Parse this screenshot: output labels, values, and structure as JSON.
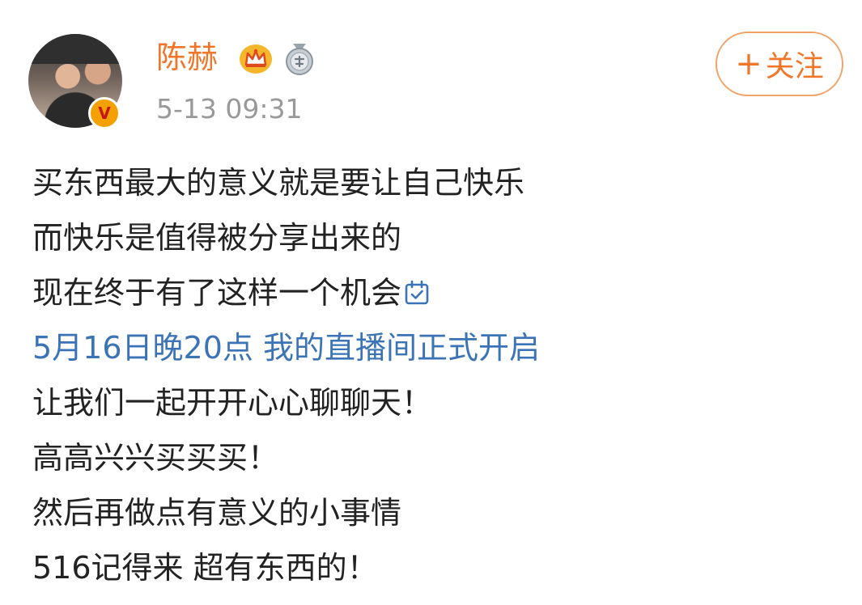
{
  "post": {
    "author": {
      "name": "陈赫",
      "avatar_icon": "avatar-photo",
      "verified_icon": "verified-v-icon",
      "badges": [
        "crown-icon",
        "medal-icon"
      ]
    },
    "timestamp": "5-13 09:31",
    "follow_button": {
      "plus": "+",
      "label": "关注"
    },
    "lines": [
      "买东西最大的意义就是要让自己快乐",
      "而快乐是值得被分享出来的",
      "现在终于有了这样一个机会",
      "5月16日晚20点 我的直播间正式开启",
      "让我们一起开开心心聊聊天！",
      "高高兴兴买买买！",
      "然后再做点有意义的小事情",
      "516记得来 超有东西的！"
    ],
    "calendar_icon": "calendar-check-icon",
    "link_line_color": "#3b73b7",
    "username_color": "#f0772a"
  }
}
